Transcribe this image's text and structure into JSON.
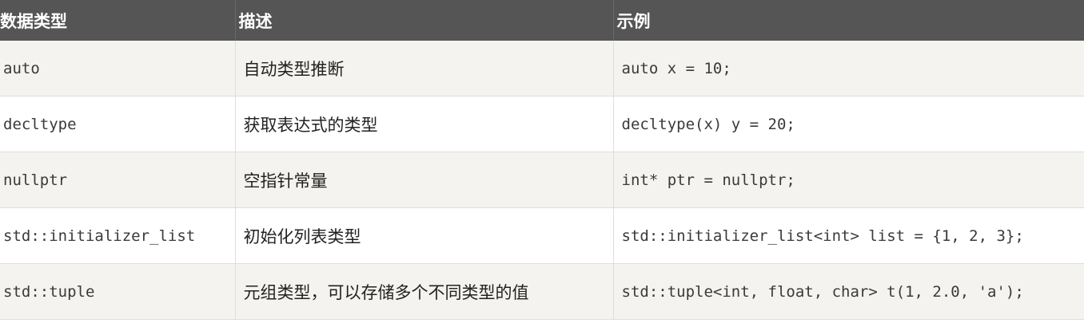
{
  "table": {
    "headers": [
      "数据类型",
      "描述",
      "示例"
    ],
    "rows": [
      {
        "type": "auto",
        "description": "自动类型推断",
        "example": "auto x = 10;"
      },
      {
        "type": "decltype",
        "description": "获取表达式的类型",
        "example": "decltype(x) y = 20;"
      },
      {
        "type": "nullptr",
        "description": "空指针常量",
        "example": "int* ptr = nullptr;"
      },
      {
        "type": "std::initializer_list",
        "description": "初始化列表类型",
        "example": "std::initializer_list<int> list = {1, 2, 3};"
      },
      {
        "type": "std::tuple",
        "description": "元组类型，可以存储多个不同类型的值",
        "example": "std::tuple<int, float, char> t(1, 2.0, 'a');"
      }
    ]
  },
  "colors": {
    "header_bg": "#555555",
    "header_text": "#ffffff",
    "row_odd_bg": "#f4f3ef",
    "row_even_bg": "#ffffff",
    "border": "#dddddd"
  }
}
